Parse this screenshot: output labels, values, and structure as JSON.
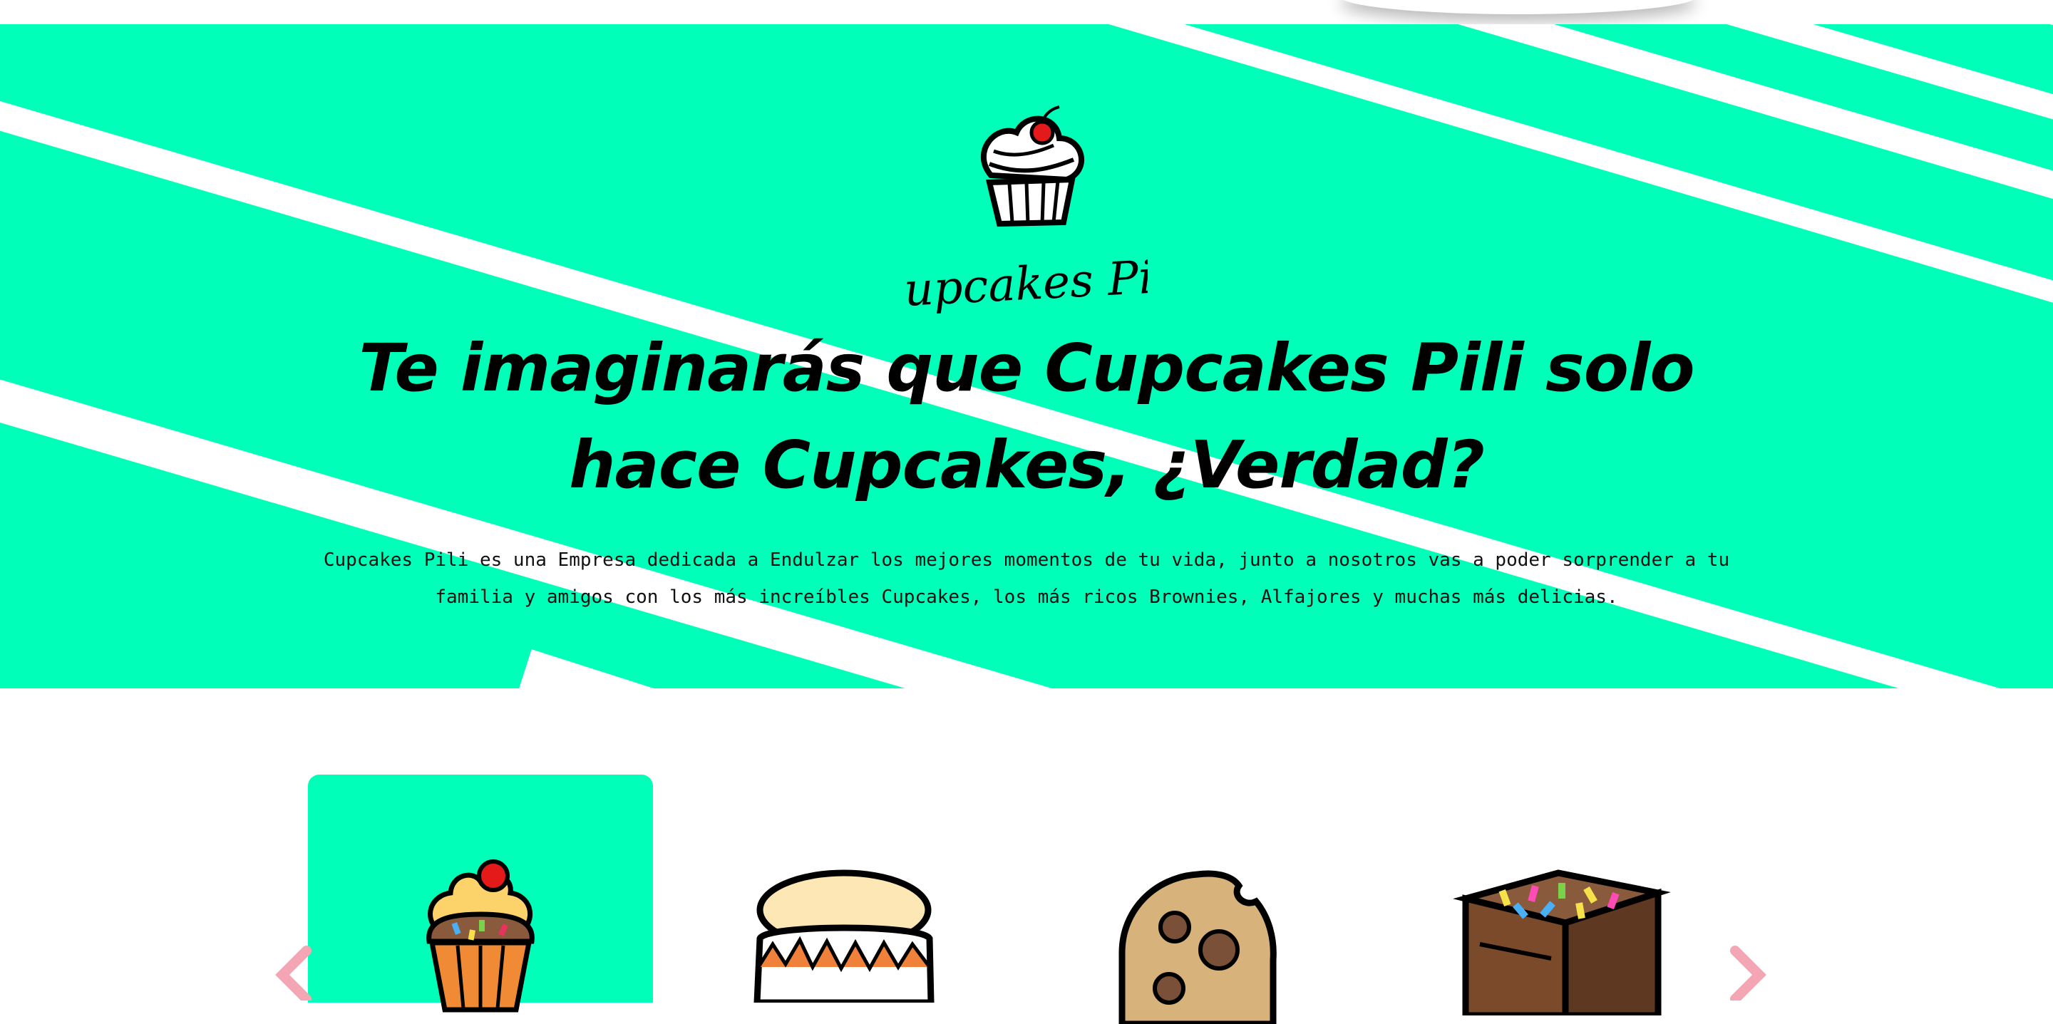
{
  "brand": {
    "name": "Cupcakes Pili",
    "accent_color": "#00ffb9",
    "arrow_color": "#f4a6b4"
  },
  "hero": {
    "title": "Te imaginarás que Cupcakes Pili solo hace Cupcakes, ¿Verdad?",
    "description": "Cupcakes Pili es una Empresa dedicada a Endulzar los mejores momentos de tu vida, junto a nosotros vas a poder sorprender a tu familia y amigos con los más increíbles Cupcakes, los más ricos Brownies, Alfajores y muchas más delicias."
  },
  "carousel": {
    "active_index": 0,
    "items": [
      {
        "icon": "cupcake-icon"
      },
      {
        "icon": "alfajor-icon"
      },
      {
        "icon": "cookie-icon"
      },
      {
        "icon": "brownie-icon"
      }
    ],
    "prev_icon": "chevron-left-icon",
    "next_icon": "chevron-right-icon"
  }
}
